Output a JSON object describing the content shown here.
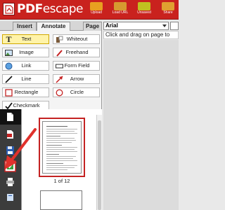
{
  "header": {
    "logo_text": "PDF",
    "logo_text2": "escape",
    "buttons": [
      {
        "label": "Upload",
        "color": "#e8a020"
      },
      {
        "label": "Load URL",
        "color": "#d69a30"
      },
      {
        "label": "Unsaved",
        "color": "#c0c020"
      },
      {
        "label": "Share",
        "color": "#e0a030"
      }
    ]
  },
  "tabs": {
    "insert": "Insert",
    "annotate": "Annotate",
    "page": "Page"
  },
  "tools": {
    "text": "Text",
    "whiteout": "Whiteout",
    "image": "Image",
    "freehand": "Freehand",
    "link": "Link",
    "formfield": "Form Field",
    "line": "Line",
    "arrow": "Arrow",
    "rectangle": "Rectangle",
    "circle": "Circle",
    "checkmark": "Checkmark"
  },
  "font": {
    "selected": "Arial"
  },
  "message": "Click and drag on page to",
  "thumbnail": {
    "label": "1 of 12"
  },
  "colors": {
    "brand": "#c9221e",
    "accent_arrow": "#e0312c",
    "selected_tool": "#fff3a8"
  }
}
